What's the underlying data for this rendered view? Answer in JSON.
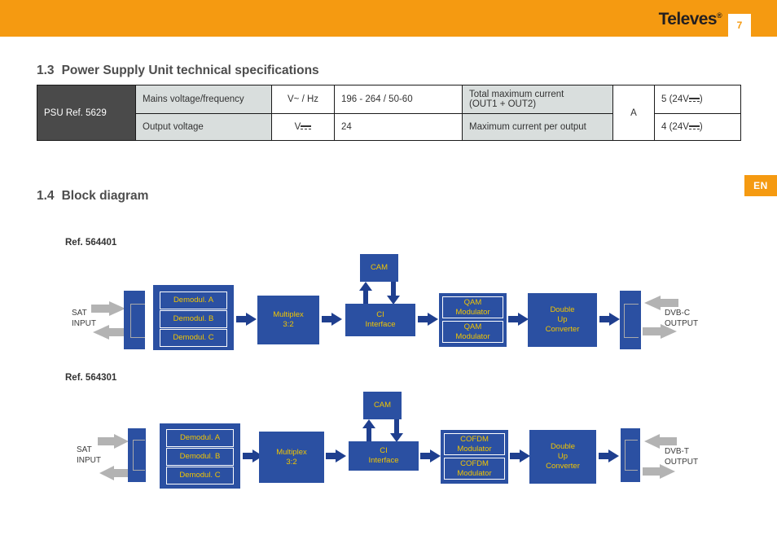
{
  "header": {
    "brand": "Televes",
    "brand_tm": "®",
    "page_number": "7",
    "band_color": "#F59A11"
  },
  "language_badge": {
    "label": "EN",
    "color": "#F59A11"
  },
  "sections": {
    "psu": {
      "number": "1.3",
      "title": "Power Supply Unit technical specifications"
    },
    "block_diagram": {
      "number": "1.4",
      "title": "Block diagram"
    }
  },
  "spec_table": {
    "ref_cell": "PSU Ref. 5629",
    "rows": [
      {
        "label": "Mains voltage/frequency",
        "unit": "V~  / Hz",
        "value": "196 - 264 /  50-60",
        "label2": "Total maximum current\n(OUT1 + OUT2)",
        "label2_line1": "Total maximum current",
        "label2_line2": "(OUT1 + OUT2)",
        "unit2": "A",
        "value2_prefix": "5  (24V",
        "value2_suffix": ")"
      },
      {
        "label": "Output voltage",
        "unit_prefix": "V",
        "value": "24",
        "label2_line1": "Maximum current per output",
        "label2_line2": "",
        "unit2": "",
        "value2_prefix": "4  (24V",
        "value2_suffix": ")"
      }
    ]
  },
  "diagrams": [
    {
      "ref": "Ref. 564401",
      "input_label_line1": "SAT",
      "input_label_line2": "INPUT",
      "demodulators": [
        "Demodul. A",
        "Demodul. B",
        "Demodul. C"
      ],
      "multiplex_line1": "Multiplex",
      "multiplex_line2": "3:2",
      "cam": "CAM",
      "ci_line1": "CI",
      "ci_line2": "Interface",
      "modulators": [
        {
          "line1": "QAM",
          "line2": "Modulator"
        },
        {
          "line1": "QAM",
          "line2": "Modulator"
        }
      ],
      "converter_line1": "Double",
      "converter_line2": "Up",
      "converter_line3": "Converter",
      "output_label_line1": "DVB-C",
      "output_label_line2": "OUTPUT"
    },
    {
      "ref": "Ref. 564301",
      "input_label_line1": "SAT",
      "input_label_line2": "INPUT",
      "demodulators": [
        "Demodul. A",
        "Demodul. B",
        "Demodul. C"
      ],
      "multiplex_line1": "Multiplex",
      "multiplex_line2": "3:2",
      "cam": "CAM",
      "ci_line1": "CI",
      "ci_line2": "Interface",
      "modulators": [
        {
          "line1": "COFDM",
          "line2": "Modulator"
        },
        {
          "line1": "COFDM",
          "line2": "Modulator"
        }
      ],
      "converter_line1": "Double",
      "converter_line2": "Up",
      "converter_line3": "Converter",
      "output_label_line1": "DVB-T",
      "output_label_line2": "OUTPUT"
    }
  ],
  "colors": {
    "block_blue": "#2B50A2",
    "block_text_yellow": "#F2C500",
    "arrow_dark": "#1F3F8F",
    "arrow_gray": "#B3B3B3",
    "orange": "#F59A11",
    "table_header_gray": "#4A4A4A",
    "table_label_gray": "#D9DEDD"
  }
}
